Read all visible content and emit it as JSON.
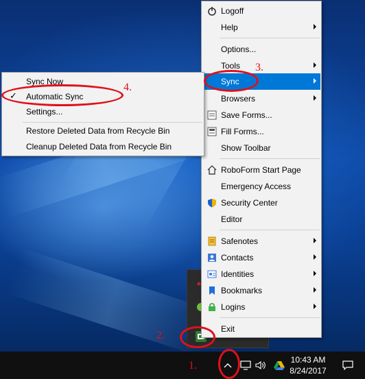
{
  "main_menu": {
    "items": [
      {
        "label": "Logoff",
        "icon": "power-icon",
        "submenu": false
      },
      {
        "label": "Help",
        "icon": "",
        "submenu": true
      },
      {
        "label": "Options...",
        "icon": "",
        "submenu": false
      },
      {
        "label": "Tools",
        "icon": "",
        "submenu": true
      },
      {
        "label": "Sync",
        "icon": "",
        "submenu": true,
        "highlighted": true
      },
      {
        "label": "Browsers",
        "icon": "",
        "submenu": true
      },
      {
        "label": "Save Forms...",
        "icon": "save-forms-icon",
        "submenu": false
      },
      {
        "label": "Fill Forms...",
        "icon": "fill-forms-icon",
        "submenu": false
      },
      {
        "label": "Show Toolbar",
        "icon": "",
        "submenu": false
      },
      {
        "label": "RoboForm Start Page",
        "icon": "home-icon",
        "submenu": false
      },
      {
        "label": "Emergency Access",
        "icon": "",
        "submenu": false
      },
      {
        "label": "Security Center",
        "icon": "shield-icon",
        "submenu": false
      },
      {
        "label": "Editor",
        "icon": "",
        "submenu": false
      },
      {
        "label": "Safenotes",
        "icon": "safenote-icon",
        "submenu": true
      },
      {
        "label": "Contacts",
        "icon": "contacts-icon",
        "submenu": true
      },
      {
        "label": "Identities",
        "icon": "identity-icon",
        "submenu": true
      },
      {
        "label": "Bookmarks",
        "icon": "bookmark-icon",
        "submenu": true
      },
      {
        "label": "Logins",
        "icon": "lock-icon",
        "submenu": true
      },
      {
        "label": "Exit",
        "icon": "",
        "submenu": false
      }
    ]
  },
  "sync_submenu": {
    "items": [
      {
        "label": "Sync Now",
        "checked": false
      },
      {
        "label": "Automatic Sync",
        "checked": true
      },
      {
        "label": "Settings...",
        "checked": false
      },
      {
        "label": "Restore Deleted Data from Recycle Bin",
        "checked": false
      },
      {
        "label": "Cleanup Deleted Data from Recycle Bin",
        "checked": false
      }
    ]
  },
  "taskbar": {
    "time": "10:43 AM",
    "date": "8/24/2017"
  },
  "annotations": {
    "step1": "1.",
    "step2": "2.",
    "step3": "3.",
    "step4": "4.",
    "color": "#e0101a"
  },
  "colors": {
    "highlight": "#0078d7",
    "menu_bg": "#f2f2f2",
    "taskbar_bg": "#101010"
  }
}
